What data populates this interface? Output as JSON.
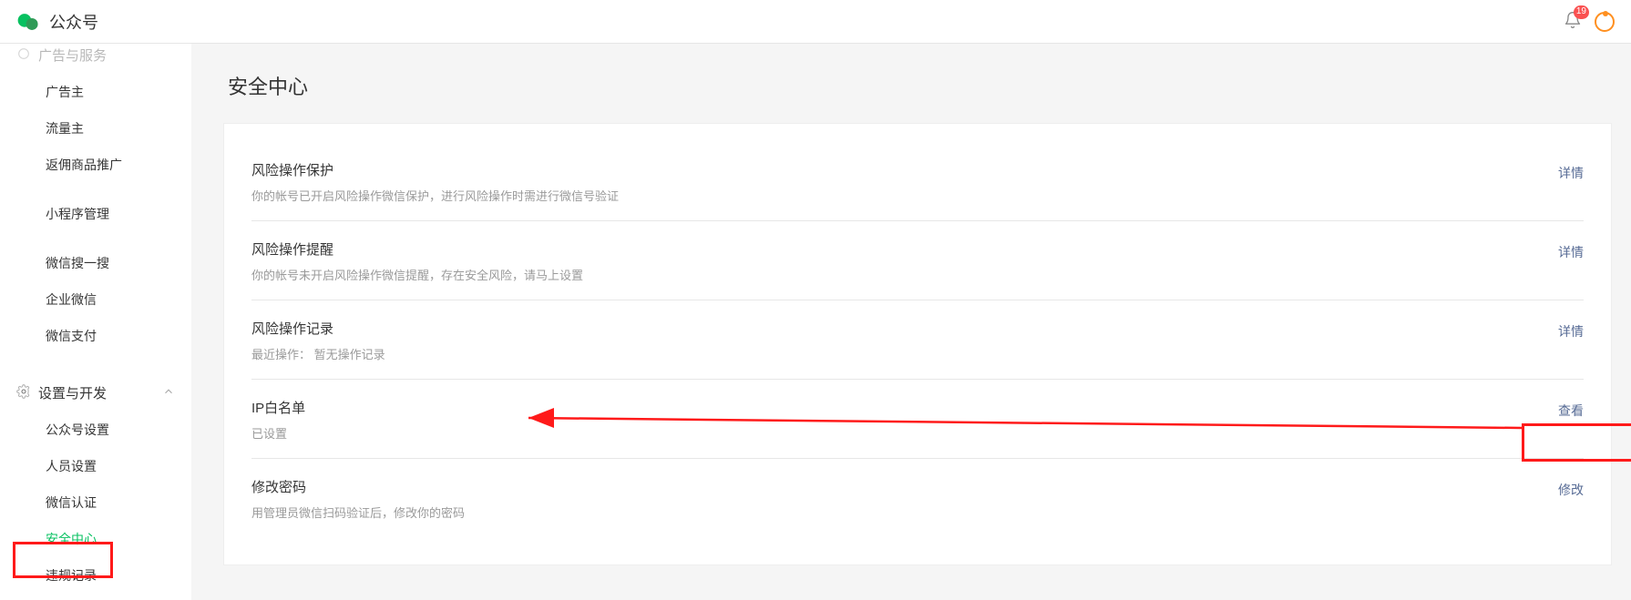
{
  "header": {
    "brand": "公众号",
    "notification_count": "19"
  },
  "sidebar": {
    "top_partial": "广告与服务",
    "items_group1": [
      {
        "label": "广告主"
      },
      {
        "label": "流量主"
      },
      {
        "label": "返佣商品推广"
      }
    ],
    "items_group2": [
      {
        "label": "小程序管理"
      }
    ],
    "items_group3": [
      {
        "label": "微信搜一搜"
      },
      {
        "label": "企业微信"
      },
      {
        "label": "微信支付"
      }
    ],
    "section_settings": {
      "title": "设置与开发",
      "items": [
        {
          "label": "公众号设置"
        },
        {
          "label": "人员设置"
        },
        {
          "label": "微信认证"
        },
        {
          "label": "安全中心",
          "active": true
        },
        {
          "label": "违规记录"
        }
      ]
    }
  },
  "main": {
    "title": "安全中心",
    "rows": [
      {
        "title": "风险操作保护",
        "desc": "你的帐号已开启风险操作微信保护，进行风险操作时需进行微信号验证",
        "action": "详情"
      },
      {
        "title": "风险操作提醒",
        "desc": "你的帐号未开启风险操作微信提醒，存在安全风险，请马上设置",
        "action": "详情"
      },
      {
        "title": "风险操作记录",
        "desc": "最近操作：  暂无操作记录",
        "action": "详情"
      },
      {
        "title": "IP白名单",
        "desc": "已设置",
        "action": "查看"
      },
      {
        "title": "修改密码",
        "desc": "用管理员微信扫码验证后，修改你的密码",
        "action": "修改"
      }
    ]
  }
}
